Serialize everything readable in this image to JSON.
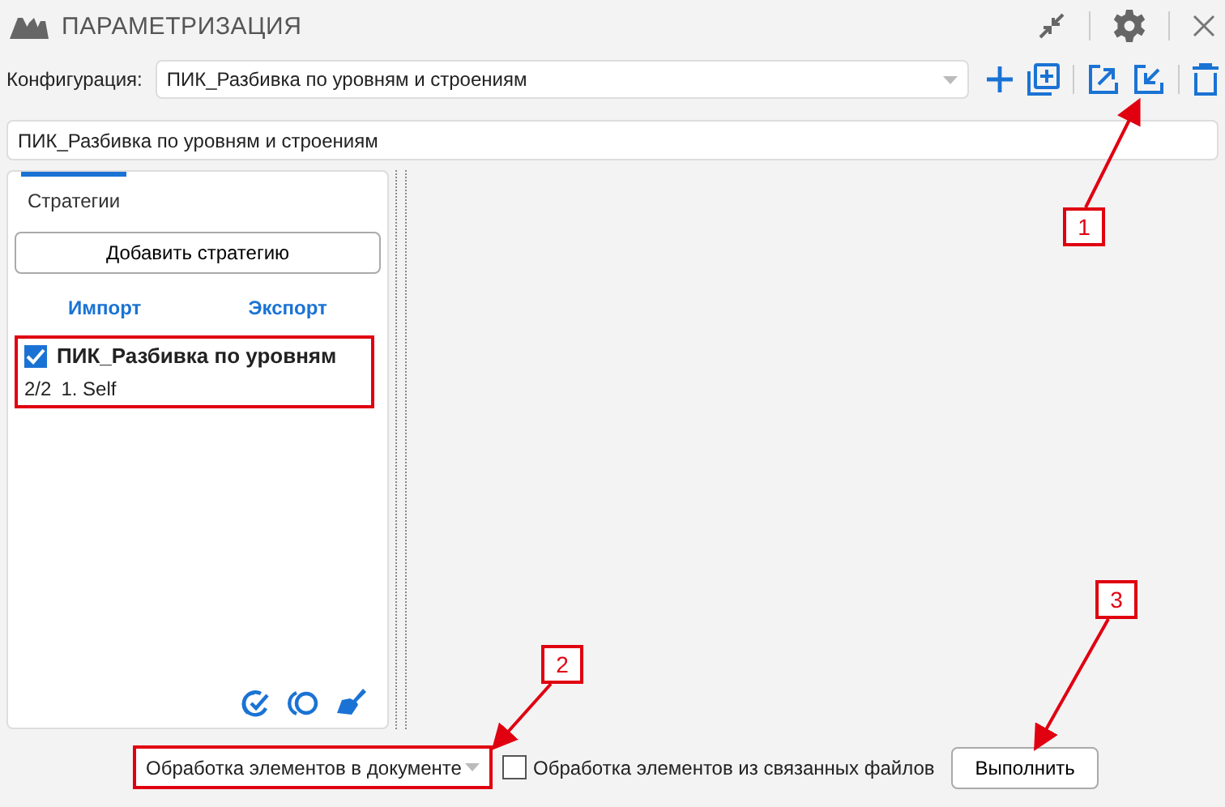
{
  "window": {
    "title": "ПАРАМЕТРИЗАЦИЯ"
  },
  "configuration": {
    "label": "Конфигурация:",
    "value": "ПИК_Разбивка по уровням и строениям"
  },
  "name_field": {
    "value": "ПИК_Разбивка по уровням и строениям"
  },
  "panel": {
    "tabs": [
      {
        "label": "Стратегии",
        "selected": true
      }
    ],
    "add_button": "Добавить стратегию",
    "links": [
      "Импорт",
      "Экспорт"
    ],
    "strategies": [
      {
        "title": "ПИК_Разбивка по уровням",
        "checked": true,
        "count": "2/2",
        "step": "1. Self"
      }
    ]
  },
  "bottom": {
    "scope": "Обработка элементов в документе",
    "linked_files": {
      "label": "Обработка элементов из связанных файлов",
      "checked": false
    },
    "run_button": "Выполнить"
  },
  "annotations": [
    {
      "label": "1"
    },
    {
      "label": "2"
    },
    {
      "label": "3"
    }
  ]
}
